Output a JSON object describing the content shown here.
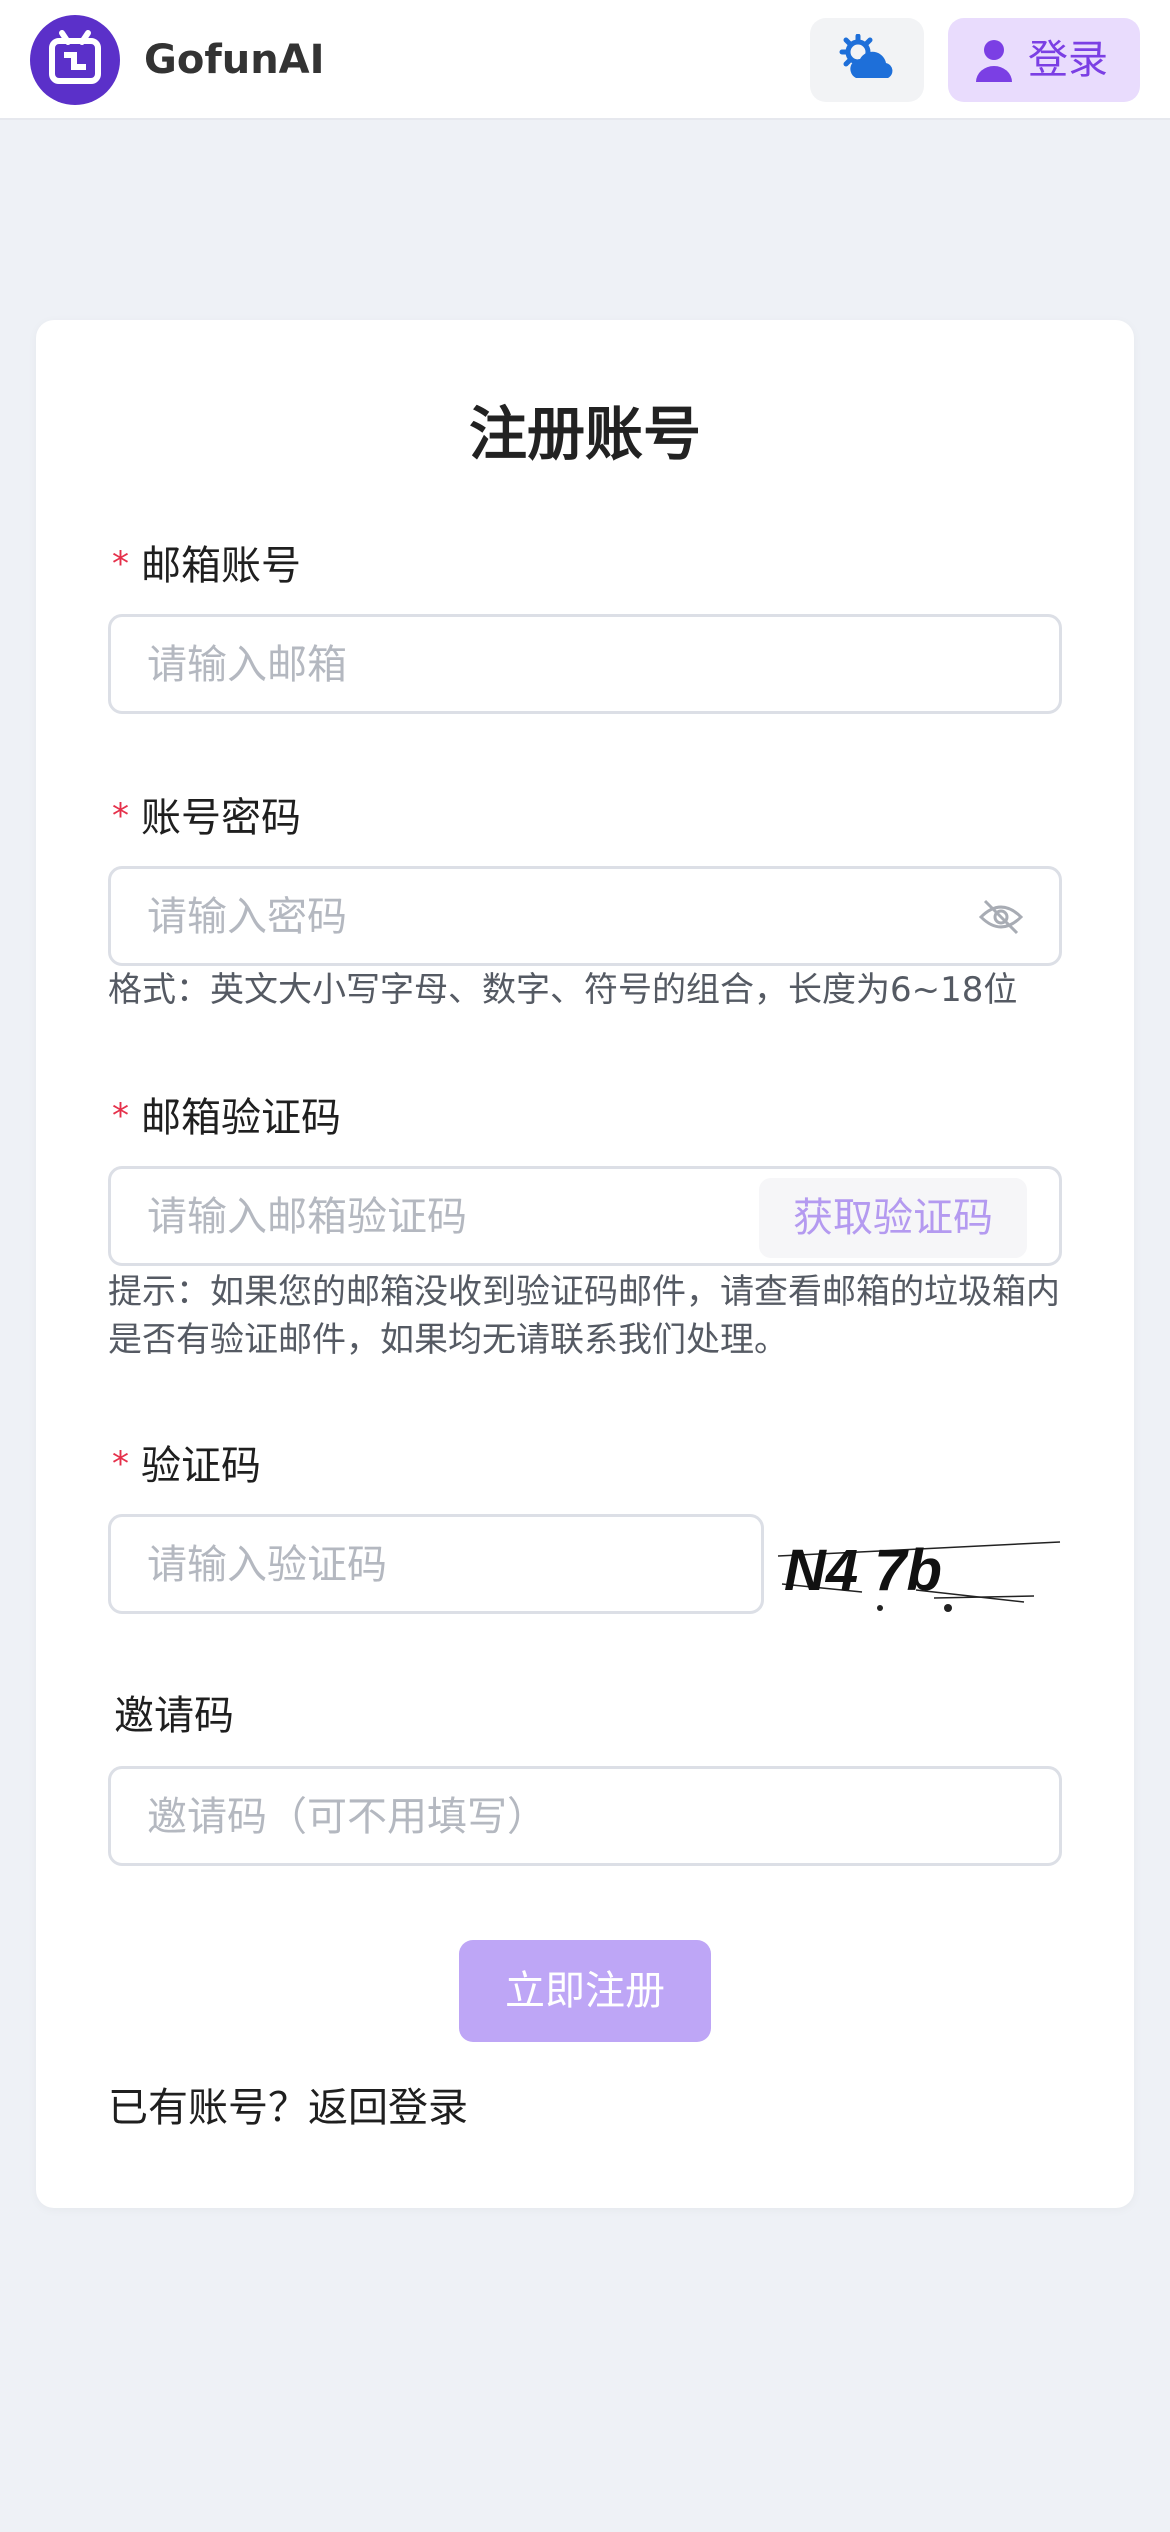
{
  "header": {
    "brand": "GofunAI",
    "theme_icon": "weather-gear-icon",
    "login_label": "登录",
    "login_icon": "user-icon",
    "accent": "#7b3fe4"
  },
  "form": {
    "title": "注册账号",
    "required_mark": "*",
    "email": {
      "label": "邮箱账号",
      "placeholder": "请输入邮箱",
      "value": ""
    },
    "password": {
      "label": "账号密码",
      "placeholder": "请输入密码",
      "value": "",
      "hint": "格式：英文大小写字母、数字、符号的组合，长度为6~18位",
      "toggle_icon": "eye-off-icon"
    },
    "email_code": {
      "label": "邮箱验证码",
      "placeholder": "请输入邮箱验证码",
      "value": "",
      "button_label": "获取验证码",
      "hint": "提示：如果您的邮箱没收到验证码邮件，请查看邮箱的垃圾箱内是否有验证邮件，如果均无请联系我们处理。"
    },
    "captcha": {
      "label": "验证码",
      "placeholder": "请输入验证码",
      "value": "",
      "image_text": "N4 7b"
    },
    "invite": {
      "label": "邀请码",
      "placeholder": "邀请码（可不用填写）",
      "value": ""
    },
    "submit_label": "立即注册",
    "back_link": "已有账号？返回登录"
  }
}
